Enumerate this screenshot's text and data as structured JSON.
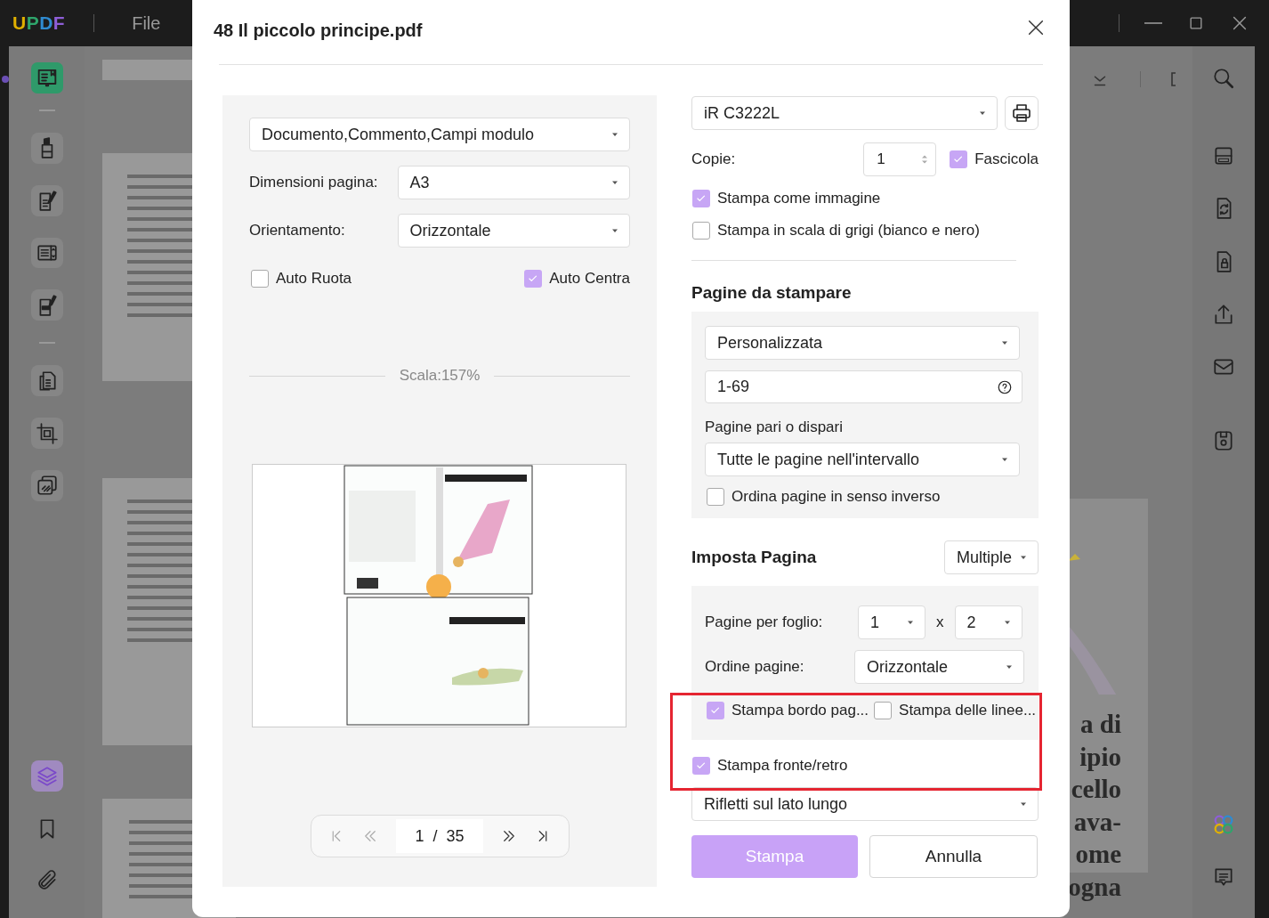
{
  "app": {
    "logo": "UPDF",
    "menu": [
      "File"
    ],
    "left_tools": [
      {
        "kind": "highlighter",
        "selected": false
      },
      {
        "kind": "edit",
        "selected": false
      },
      {
        "kind": "form",
        "selected": false
      },
      {
        "kind": "redact",
        "selected": false
      },
      {
        "kind": "pages",
        "selected": false
      },
      {
        "kind": "crop",
        "selected": false
      },
      {
        "kind": "watermark",
        "selected": false
      },
      {
        "kind": "layers",
        "selected": true
      },
      {
        "kind": "bookmark",
        "selected": false
      },
      {
        "kind": "attachment",
        "selected": false
      }
    ],
    "right_tools": [
      {
        "kind": "ocr"
      },
      {
        "kind": "convert"
      },
      {
        "kind": "protect"
      },
      {
        "kind": "share"
      },
      {
        "kind": "mail"
      },
      {
        "kind": "save"
      }
    ],
    "page_text": [
      "a di",
      "ipio",
      "cello",
      "ava-",
      "ome",
      "ogna"
    ]
  },
  "dialog": {
    "title": "48 Il piccolo principe.pdf",
    "left": {
      "content": "Documento,Commento,Campi modulo",
      "fields": [
        {
          "label": "Dimensioni pagina:",
          "value": "A3"
        },
        {
          "label": "Orientamento:",
          "value": "Orizzontale"
        }
      ],
      "options": [
        {
          "label": "Auto Ruota",
          "checked": false
        },
        {
          "label": "Auto Centra",
          "checked": true
        }
      ],
      "scale": "Scala:157%",
      "pager": {
        "current": "1",
        "separator": "/",
        "total": "35"
      }
    },
    "right": {
      "printer": "iR C3222L",
      "copies_label": "Copie:",
      "copies": "1",
      "collate": {
        "label": "Fascicola",
        "checked": true
      },
      "options": [
        {
          "label": "Stampa come immagine",
          "checked": true
        },
        {
          "label": "Stampa in scala di grigi (bianco e nero)",
          "checked": false
        }
      ],
      "pages": {
        "heading": "Pagine da stampare",
        "range_mode": "Personalizzata",
        "range": "1-69",
        "parity_label": "Pagine pari o dispari",
        "parity": "Tutte le pagine nell'intervallo",
        "reverse": {
          "label": "Ordina pagine in senso inverso",
          "checked": false
        }
      },
      "layout": {
        "heading": "Imposta Pagina",
        "mode": "Multiple",
        "per_sheet_label": "Pagine per foglio:",
        "rows": "1",
        "times": "x",
        "cols": "2",
        "order_label": "Ordine pagine:",
        "order": "Orizzontale",
        "borders": [
          {
            "label": "Stampa bordo pag...",
            "checked": true
          },
          {
            "label": "Stampa delle linee...",
            "checked": false
          }
        ]
      },
      "duplex": {
        "label": "Stampa fronte/retro",
        "checked": true
      },
      "flip": "Rifletti sul lato lungo",
      "buttons": [
        {
          "label": "Stampa",
          "kind": "primary"
        },
        {
          "label": "Annulla",
          "kind": "secondary"
        }
      ]
    }
  }
}
